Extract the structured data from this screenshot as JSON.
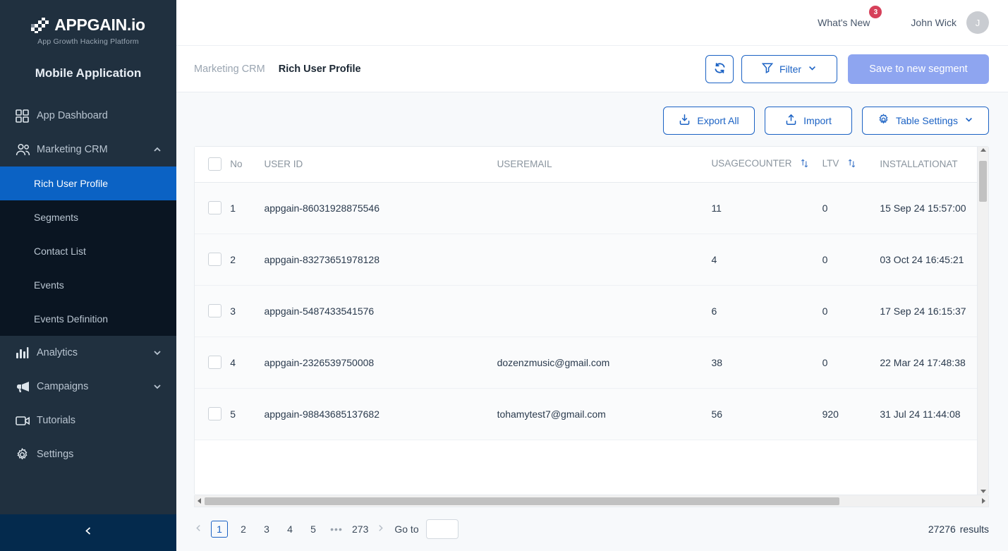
{
  "brand": {
    "name": "APPGAIN.io",
    "tagline": "App Growth Hacking Platform",
    "app_title": "Mobile Application"
  },
  "sidebar": {
    "items": [
      {
        "label": "App Dashboard",
        "icon": "grid-icon",
        "expandable": false
      },
      {
        "label": "Marketing CRM",
        "icon": "users-icon",
        "expandable": true,
        "expanded": true
      },
      {
        "label": "Analytics",
        "icon": "bar-chart-icon",
        "expandable": true,
        "expanded": false
      },
      {
        "label": "Campaigns",
        "icon": "megaphone-icon",
        "expandable": true,
        "expanded": false
      },
      {
        "label": "Tutorials",
        "icon": "video-icon",
        "expandable": false
      },
      {
        "label": "Settings",
        "icon": "gear-icon",
        "expandable": false
      }
    ],
    "submenu": [
      {
        "label": "Rich User Profile",
        "active": true
      },
      {
        "label": "Segments",
        "active": false
      },
      {
        "label": "Contact List",
        "active": false
      },
      {
        "label": "Events",
        "active": false
      },
      {
        "label": "Events Definition",
        "active": false
      }
    ],
    "collapse_icon": "chevron-left-icon"
  },
  "topbar": {
    "whats_new": "What's New",
    "whats_new_badge": "3",
    "user_name": "John Wick",
    "avatar_initial": "J"
  },
  "breadcrumb": {
    "parent": "Marketing CRM",
    "current": "Rich User Profile"
  },
  "actions": {
    "refresh_icon": "refresh-icon",
    "filter_label": "Filter",
    "save_segment_label": "Save to new segment",
    "export_label": "Export All",
    "import_label": "Import",
    "table_settings_label": "Table Settings"
  },
  "table": {
    "columns": [
      {
        "key": "no",
        "label": "No",
        "sortable": false
      },
      {
        "key": "user_id",
        "label": "USER ID",
        "sortable": false
      },
      {
        "key": "user_email",
        "label": "USEREMAIL",
        "sortable": false
      },
      {
        "key": "usage_counter",
        "label": "USAGECOUNTER",
        "sortable": true
      },
      {
        "key": "ltv",
        "label": "LTV",
        "sortable": true
      },
      {
        "key": "installation_at",
        "label": "INSTALLATIONAT",
        "sortable": false
      }
    ],
    "rows": [
      {
        "no": "1",
        "user_id": "appgain-86031928875546",
        "user_email": "",
        "usage_counter": "11",
        "ltv": "0",
        "installation_at": "15 Sep 24 15:57:00"
      },
      {
        "no": "2",
        "user_id": "appgain-83273651978128",
        "user_email": "",
        "usage_counter": "4",
        "ltv": "0",
        "installation_at": "03 Oct 24 16:45:21"
      },
      {
        "no": "3",
        "user_id": "appgain-5487433541576",
        "user_email": "",
        "usage_counter": "6",
        "ltv": "0",
        "installation_at": "17 Sep 24 16:15:37"
      },
      {
        "no": "4",
        "user_id": "appgain-2326539750008",
        "user_email": "dozenzmusic@gmail.com",
        "usage_counter": "38",
        "ltv": "0",
        "installation_at": "22 Mar 24 17:48:38"
      },
      {
        "no": "5",
        "user_id": "appgain-98843685137682",
        "user_email": "tohamytest7@gmail.com",
        "usage_counter": "56",
        "ltv": "920",
        "installation_at": "31 Jul 24 11:44:08"
      }
    ]
  },
  "pagination": {
    "prev_icon": "chevron-left-icon",
    "next_icon": "chevron-right-icon",
    "pages": [
      "1",
      "2",
      "3",
      "4",
      "5"
    ],
    "ellipsis": "•••",
    "last_page": "273",
    "current_page": "1",
    "goto_label": "Go to",
    "goto_value": "",
    "results_count": "27276",
    "results_label": "results"
  },
  "colors": {
    "sidebar_bg": "#20303f",
    "submenu_bg": "#0a1522",
    "active_blue": "#0b62c4",
    "accent_blue": "#1b62c4",
    "save_button": "#8ea5f0",
    "badge_red": "#d6405a"
  }
}
